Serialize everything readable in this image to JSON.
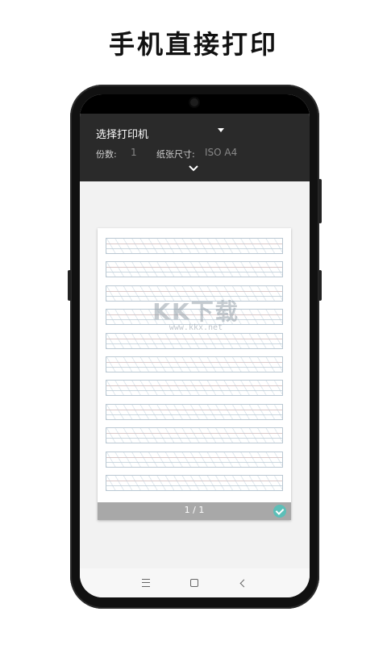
{
  "headline": "手机直接打印",
  "toolbar": {
    "printer_label": "选择打印机",
    "copies_label": "份数:",
    "copies_value": "1",
    "paper_label": "纸张尺寸:",
    "paper_value": "ISO A4"
  },
  "preview": {
    "watermark_logo": "KK下载",
    "watermark_url": "www.kkx.net",
    "page_count": "1 / 1",
    "row_count": 11
  },
  "colors": {
    "toolbar_bg": "#2a2a2a",
    "accent_check": "#5cbfb8",
    "page_bar": "#a8a8a8"
  },
  "icons": {
    "dropdown": "dropdown-icon",
    "expand": "chevron-down-icon",
    "check": "check-icon",
    "nav_menu": "menu-icon",
    "nav_home": "home-icon",
    "nav_back": "back-icon"
  }
}
